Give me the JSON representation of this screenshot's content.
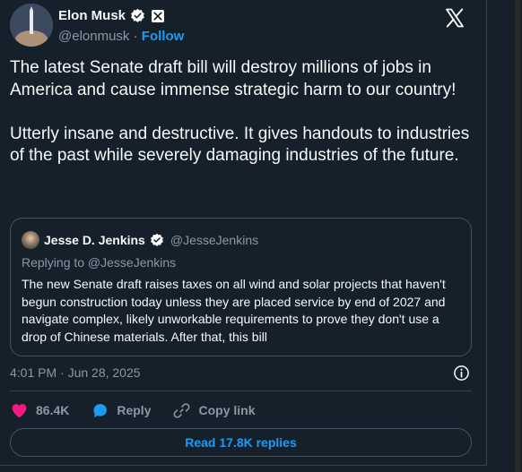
{
  "author": {
    "display_name": "Elon Musk",
    "handle": "@elonmusk",
    "separator": " · ",
    "follow_label": "Follow"
  },
  "tweet": {
    "text": "The latest Senate draft bill will destroy millions of jobs in America and cause immense strategic harm to our country!\n\nUtterly insane and destructive. It gives handouts to industries of the past while severely damaging industries of the future.",
    "timestamp": "4:01 PM · Jun 28, 2025"
  },
  "quoted": {
    "display_name": "Jesse D. Jenkins",
    "handle": "@JesseJenkins",
    "replying_to": "Replying to @JesseJenkins",
    "text": "The new Senate draft raises taxes on all wind and solar projects that haven't begun construction today unless they are placed service by end of 2027 and navigate complex, likely unworkable requirements to prove they don't use a drop of Chinese materials. After that, this bill"
  },
  "actions": {
    "like_count": "86.4K",
    "reply_label": "Reply",
    "copy_link_label": "Copy link"
  },
  "read_replies_label": "Read 17.8K replies",
  "colors": {
    "background": "#15202b",
    "accent": "#1d9bf0",
    "like": "#f91880",
    "secondary_text": "#8b98a5"
  },
  "icons": [
    "verified-icon",
    "x-affiliation-icon",
    "x-logo-icon",
    "info-icon",
    "heart-icon",
    "reply-bubble-icon",
    "link-icon"
  ]
}
